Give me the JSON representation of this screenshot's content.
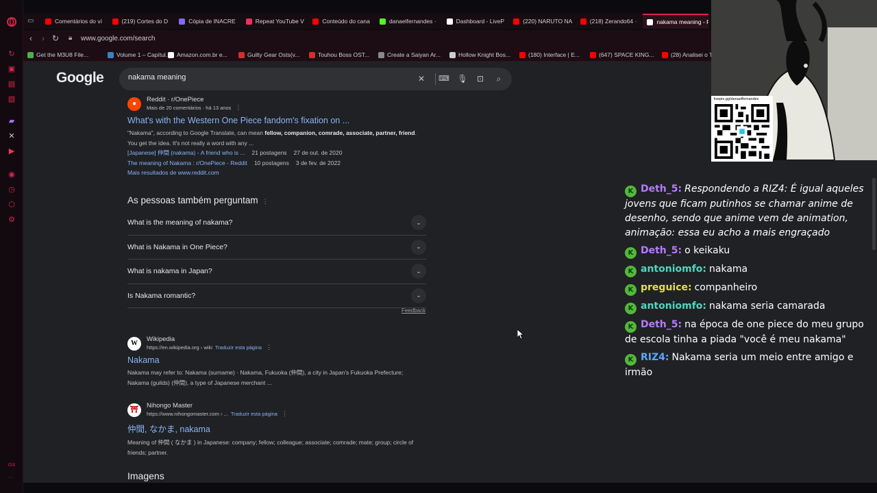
{
  "tabs": [
    {
      "label": "Comentários do ví",
      "color": "#ff0000"
    },
    {
      "label": "(219) Cortes do D",
      "color": "#ff0000"
    },
    {
      "label": "Cópia de INACRE",
      "color": "#7d6cf0"
    },
    {
      "label": "Repeat YouTube V",
      "color": "#e8325d"
    },
    {
      "label": "Conteúdo do cana",
      "color": "#ff0000"
    },
    {
      "label": "danaelfernandes ·",
      "color": "#53fc18"
    },
    {
      "label": "Dashboard - LiveP",
      "color": "#ffffff"
    },
    {
      "label": "(220) NARUTO NA",
      "color": "#ff0000"
    },
    {
      "label": "(218) Zerando64 ·",
      "color": "#ff0000"
    },
    {
      "label": "nakama meaning - P",
      "color": "#ffffff",
      "active": true
    }
  ],
  "address": {
    "url": "www.google.com/search"
  },
  "bookmarks": [
    {
      "label": "Get the M3U8 File...",
      "color": "#4caf50"
    },
    {
      "label": "Volume 1 – Capítul...",
      "color": "#3b82c4"
    },
    {
      "label": "Amazon.com.br e...",
      "color": "#ffffff"
    },
    {
      "label": "Guilty Gear Osts(v...",
      "color": "#d32f2f"
    },
    {
      "label": "Touhou Boss OST...",
      "color": "#d32f2f"
    },
    {
      "label": "Create a Saiyan Ar...",
      "color": "#888888"
    },
    {
      "label": "Hollow Knight Bos...",
      "color": "#cccccc"
    },
    {
      "label": "(180) Interface | E...",
      "color": "#ff0000"
    },
    {
      "label": "(647) SPACE KING...",
      "color": "#ff0000"
    },
    {
      "label": "(28) Analisei o T",
      "color": "#ff0000"
    }
  ],
  "google": {
    "logo": "Google",
    "query": "nakama meaning",
    "reddit": {
      "source": "Reddit · r/OnePiece",
      "meta": "Mais de 20 comentários · há 13 anos",
      "title": "What's with the Western One Piece fandom's fixation on ...",
      "snippet_a": "\"Nakama\", according to Google Translate, can mean ",
      "snippet_b": "fellow, companion, comrade, associate, partner, friend",
      "snippet_c": ". You get the idea. It's not really a word with any ...",
      "sub1_link": "[Japanese] 仲間 (nakama) - A friend who is ...",
      "sub1_count": "21 postagens",
      "sub1_date": "27 de out. de 2020",
      "sub2_link": "The meaning of Nakama : r/OnePiece - Reddit",
      "sub2_count": "10 postagens",
      "sub2_date": "3 de fev. de 2022",
      "more": "Mais resultados de www.reddit.com"
    },
    "paa": {
      "title": "As pessoas também perguntam",
      "questions": [
        "What is the meaning of nakama?",
        "What is Nakama in One Piece?",
        "What is nakama in Japan?",
        "Is Nakama romantic?"
      ],
      "feedback": "Feedback"
    },
    "wikipedia": {
      "source": "Wikipedia",
      "url": "https://en.wikipedia.org › wiki",
      "translate": "Traduzir esta página",
      "title": "Nakama",
      "snippet": "Nakama may refer to: Nakama (surname) · Nakama, Fukuoka (仲間), a city in Japan's Fukuoka Prefecture; Nakama (guilds) (仲間), a type of Japanese merchant ..."
    },
    "nihongo": {
      "source": "Nihongo Master",
      "url": "https://www.nihongomaster.com › ...",
      "translate": "Traduzir esta página",
      "title": "仲間, なかま, nakama",
      "snippet": "Meaning of 仲間 ( なかま ) in Japanese: company; fellow; colleague; associate; comrade; mate; group; circle of friends; partner."
    },
    "images_heading": "Imagens"
  },
  "overlay": {
    "qr_caption": "livepix.gg/danaelfernandes",
    "chat": [
      {
        "user": "Deth_5:",
        "color": "#b57bff",
        "text": "Respondendo a RIZ4: É igual aqueles jovens que ficam putinhos se chamar anime de desenho, sendo que anime vem de animation, animação:  essa eu acho a mais engraçado"
      },
      {
        "user": "Deth_5:",
        "color": "#b57bff",
        "text": "o keikaku"
      },
      {
        "user": "antoniomfo:",
        "color": "#4fd6c0",
        "text": "nakama"
      },
      {
        "user": "preguice:",
        "color": "#e4e23b",
        "text": "companheiro"
      },
      {
        "user": "antoniomfo:",
        "color": "#4fd6c0",
        "text": "nakama seria camarada"
      },
      {
        "user": "Deth_5:",
        "color": "#b57bff",
        "text": "na época de one piece do meu grupo de escola tinha a piada \"você é meu nakama\""
      },
      {
        "user": "RIZ4:",
        "color": "#5aa8ff",
        "text": "Nakama seria um meio entre amigo e irmão"
      }
    ]
  },
  "gx_label": "GX"
}
